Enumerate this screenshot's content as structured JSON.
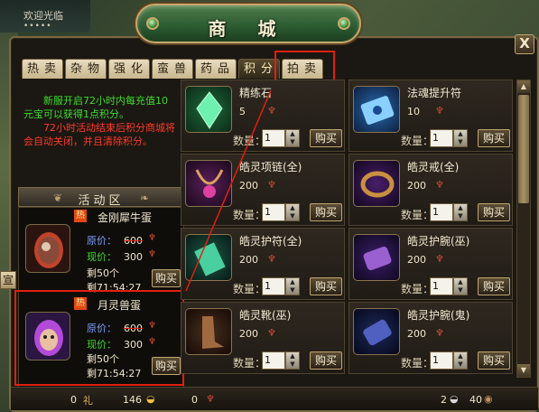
{
  "welcome": {
    "text": "欢迎光临",
    "dots": "•••••"
  },
  "window": {
    "title": "商  城",
    "close": "X"
  },
  "tabs": [
    {
      "label": "热卖"
    },
    {
      "label": "杂物"
    },
    {
      "label": "强化"
    },
    {
      "label": "蛮兽"
    },
    {
      "label": "药品"
    },
    {
      "label": "积分"
    },
    {
      "label": "拍卖"
    }
  ],
  "promo": {
    "green": "新服开启72小时内每充值10元宝可以获得1点积分。",
    "red": "72小时活动结束后积分商城将会自动关闭，并且清除积分。"
  },
  "activity": {
    "title": "活动区",
    "left_tab": "宣",
    "items": [
      {
        "hot": "热",
        "name": "金刚犀牛蛋",
        "orig_label": "原价：",
        "orig": "600",
        "now_label": "现价：",
        "now": "300",
        "left": "剩50个",
        "time": "剩71:54:27",
        "buy": "购买"
      },
      {
        "hot": "热",
        "name": "月灵兽蛋",
        "orig_label": "原价：",
        "orig": "600",
        "now_label": "现价：",
        "now": "300",
        "left": "剩50个",
        "time": "剩71:54:27",
        "buy": "购买"
      }
    ]
  },
  "products": [
    {
      "name": "精练石",
      "price": "5",
      "qty_label": "数量：",
      "qty": "1",
      "buy": "购买",
      "icon": "green-crystal-icon"
    },
    {
      "name": "法魂提升符",
      "price": "10",
      "qty_label": "数量：",
      "qty": "1",
      "buy": "购买",
      "icon": "blue-talisman-icon"
    },
    {
      "name": "皓灵项链(全)",
      "price": "200",
      "qty_label": "数量：",
      "qty": "1",
      "buy": "购买",
      "icon": "necklace-icon"
    },
    {
      "name": "皓灵戒(全)",
      "price": "200",
      "qty_label": "数量：",
      "qty": "1",
      "buy": "购买",
      "icon": "ring-icon"
    },
    {
      "name": "皓灵护符(全)",
      "price": "200",
      "qty_label": "数量：",
      "qty": "1",
      "buy": "购买",
      "icon": "amulet-icon"
    },
    {
      "name": "皓灵护腕(巫)",
      "price": "200",
      "qty_label": "数量：",
      "qty": "1",
      "buy": "购买",
      "icon": "bracer-icon"
    },
    {
      "name": "皓灵靴(巫)",
      "price": "200",
      "qty_label": "数量：",
      "qty": "1",
      "buy": "购买",
      "icon": "boots-icon"
    },
    {
      "name": "皓灵护腕(鬼)",
      "price": "200",
      "qty_label": "数量：",
      "qty": "1",
      "buy": "购买",
      "icon": "bracer-dark-icon"
    }
  ],
  "status": {
    "v1": "0",
    "v1_tag": "礼",
    "v2": "146",
    "v3": "0",
    "v4": "2",
    "v5": "40"
  },
  "colors": {
    "highlight": "#e02010",
    "green_text": "#3fdc30",
    "red_text": "#ff3a2a"
  }
}
